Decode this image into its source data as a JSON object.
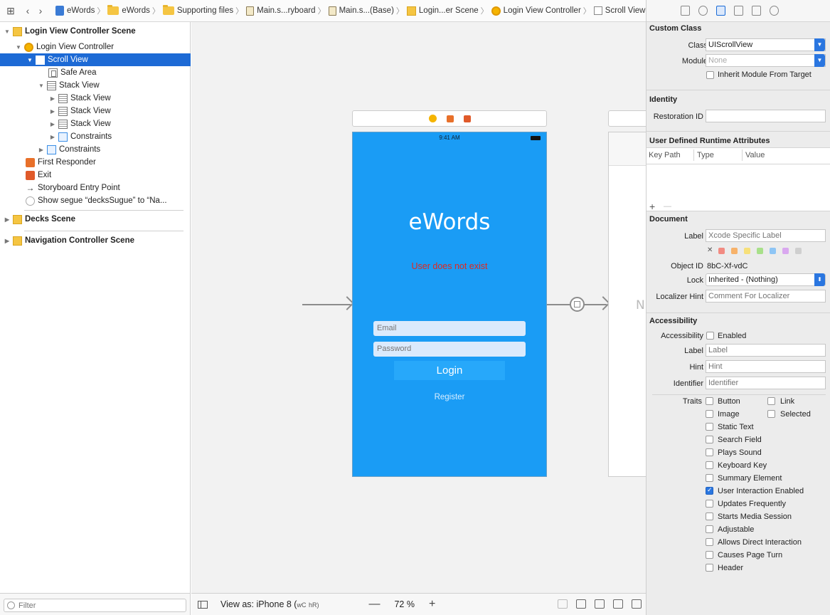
{
  "breadcrumbs": [
    "eWords",
    "eWords",
    "Supporting files",
    "Main.s...ryboard",
    "Main.s...(Base)",
    "Login...er Scene",
    "Login View Controller",
    "Scroll View"
  ],
  "outline": {
    "scene1": "Login View Controller Scene",
    "vc": "Login View Controller",
    "scroll": "Scroll View",
    "safe": "Safe Area",
    "stack": "Stack View",
    "stack1": "Stack View",
    "stack2": "Stack View",
    "stack3": "Stack View",
    "cons_inner": "Constraints",
    "cons_outer": "Constraints",
    "responder": "First Responder",
    "exit": "Exit",
    "entry": "Storyboard Entry Point",
    "segue": "Show segue “decksSugue” to “Na...",
    "scene2": "Decks Scene",
    "scene3": "Navigation Controller Scene"
  },
  "filter_placeholder": "Filter",
  "phone": {
    "time": "9:41 AM",
    "title": "eWords",
    "error": "User does not exist",
    "email_placeholder": "Email",
    "password_placeholder": "Password",
    "login": "Login",
    "register": "Register",
    "next_scene_letter": "N"
  },
  "bottom": {
    "view_as": "View as: iPhone 8 (",
    "size_w": "wC",
    "size_h": "hR)",
    "minus": "—",
    "zoom": "72 %",
    "plus": "+"
  },
  "inspector": {
    "custom_class": "Custom Class",
    "class_label": "Class",
    "class_value": "UIScrollView",
    "module_label": "Module",
    "module_value": "None",
    "inherit": "Inherit Module From Target",
    "identity": "Identity",
    "restoration_label": "Restoration ID",
    "udra": "User Defined Runtime Attributes",
    "key_path": "Key Path",
    "type": "Type",
    "value": "Value",
    "add": "+",
    "remove": "—",
    "document": "Document",
    "doc_label": "Label",
    "doc_label_ph": "Xcode Specific Label",
    "clear_color": "✕",
    "object_id_label": "Object ID",
    "object_id": "8bC-Xf-vdC",
    "lock_label": "Lock",
    "lock_value": "Inherited - (Nothing)",
    "localizer_label": "Localizer Hint",
    "localizer_ph": "Comment For Localizer",
    "accessibility": "Accessibility",
    "acc_label": "Accessibility",
    "enabled": "Enabled",
    "label_label": "Label",
    "label_ph": "Label",
    "hint_label": "Hint",
    "hint_ph": "Hint",
    "identifier_label": "Identifier",
    "identifier_ph": "Identifier",
    "traits_label": "Traits",
    "traits": {
      "button": "Button",
      "link": "Link",
      "image": "Image",
      "selected": "Selected",
      "static_text": "Static Text",
      "search_field": "Search Field",
      "plays_sound": "Plays Sound",
      "keyboard_key": "Keyboard Key",
      "summary_element": "Summary Element",
      "user_interaction": "User Interaction Enabled",
      "updates_frequently": "Updates Frequently",
      "starts_media": "Starts Media Session",
      "adjustable": "Adjustable",
      "direct_interaction": "Allows Direct Interaction",
      "page_turn": "Causes Page Turn",
      "header": "Header"
    }
  },
  "colors": {
    "selection": "#1d6ad5",
    "phone_bg": "#1a9cf5",
    "error": "#e0281e"
  }
}
